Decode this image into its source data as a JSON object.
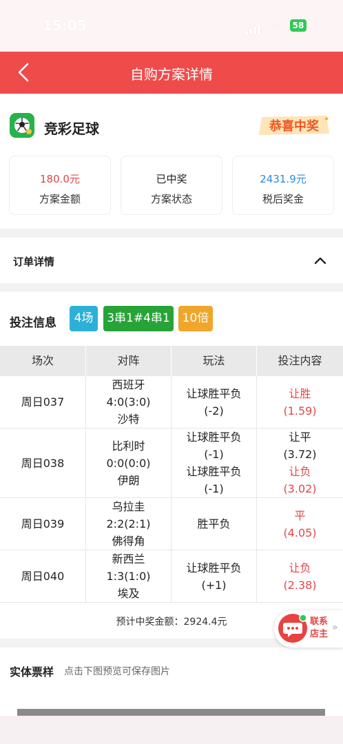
{
  "status_bar": {
    "time": "15:05",
    "battery": "58"
  },
  "nav": {
    "title": "自购方案详情"
  },
  "header": {
    "app_name": "竞彩足球",
    "badge_text": "恭喜中奖",
    "stats": [
      {
        "value": "180.0元",
        "label": "方案金额",
        "color": "#e54545"
      },
      {
        "value": "已中奖",
        "label": "方案状态",
        "color": "#222222"
      },
      {
        "value": "2431.9元",
        "label": "税后奖金",
        "color": "#2a8be2"
      }
    ]
  },
  "order": {
    "label": "订单详情"
  },
  "bet_info": {
    "label": "投注信息",
    "tags": [
      {
        "text": "4场",
        "color": "#2db0d8"
      },
      {
        "text": "3串1#4串1",
        "color": "#27a338"
      },
      {
        "text": "10倍",
        "color": "#f0a52b"
      }
    ]
  },
  "table": {
    "headers": [
      "场次",
      "对阵",
      "玩法",
      "投注内容"
    ],
    "rows": [
      {
        "match_no": "周日037",
        "home": "西班牙",
        "score": "4:0(3:0)",
        "away": "沙特",
        "plays": [
          {
            "name": "让球胜平负",
            "handicap": "(-2)"
          }
        ],
        "picks": [
          {
            "pick": "让胜",
            "odds": "(1.59)",
            "color": "#e54545"
          }
        ]
      },
      {
        "match_no": "周日038",
        "home": "比利时",
        "score": "0:0(0:0)",
        "away": "伊朗",
        "plays": [
          {
            "name": "让球胜平负",
            "handicap": "(-1)"
          },
          {
            "name": "让球胜平负",
            "handicap": "(-1)"
          }
        ],
        "picks": [
          {
            "pick": "让平",
            "odds": "(3.72)",
            "color": "#222222"
          },
          {
            "pick": "让负",
            "odds": "(3.02)",
            "color": "#e54545"
          }
        ]
      },
      {
        "match_no": "周日039",
        "home": "乌拉圭",
        "score": "2:2(2:1)",
        "away": "佛得角",
        "plays": [
          {
            "name": "胜平负",
            "handicap": ""
          }
        ],
        "picks": [
          {
            "pick": "平",
            "odds": "(4.05)",
            "color": "#e54545"
          }
        ]
      },
      {
        "match_no": "周日040",
        "home": "新西兰",
        "score": "1:3(1:0)",
        "away": "埃及",
        "plays": [
          {
            "name": "让球胜平负",
            "handicap": "(+1)"
          }
        ],
        "picks": [
          {
            "pick": "让负",
            "odds": "(2.38)",
            "color": "#e54545"
          }
        ]
      }
    ]
  },
  "prize_estimate": "预计中奖金额：2924.4元",
  "contact": {
    "label": "联系店主"
  },
  "ticket": {
    "label": "实体票样",
    "hint": "点击下图预览可保存图片"
  }
}
